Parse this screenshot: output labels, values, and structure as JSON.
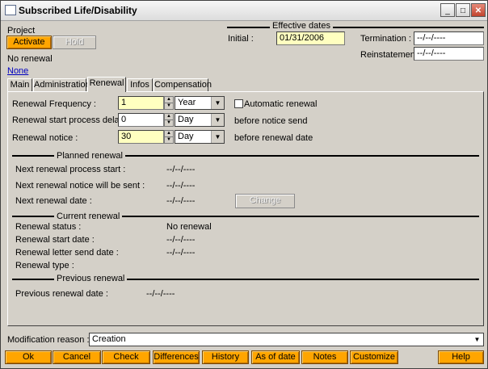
{
  "window": {
    "title": "Subscribed Life/Disability"
  },
  "project": {
    "label": "Project",
    "activate_label": "Activate",
    "hold_label": "Hold",
    "renewal_status": "No renewal",
    "none_link": "None"
  },
  "effective_dates": {
    "title": "Effective dates",
    "initial_label": "Initial :",
    "initial_value": "01/31/2006",
    "termination_label": "Termination :",
    "termination_value": "--/--/----",
    "reinstatement_label": "Reinstatement :",
    "reinstatement_value": "--/--/----"
  },
  "tabs": [
    {
      "label": "Main"
    },
    {
      "label": "Administration"
    },
    {
      "label": "Renewal"
    },
    {
      "label": "Infos"
    },
    {
      "label": "Compensation"
    }
  ],
  "renewal": {
    "frequency_label": "Renewal Frequency :",
    "frequency_value": "1",
    "frequency_unit": "Year",
    "automatic_label": "Automatic renewal",
    "delay_label": "Renewal start process delay :",
    "delay_value": "0",
    "delay_unit": "Day",
    "delay_suffix": "before notice send",
    "notice_label": "Renewal notice :",
    "notice_value": "30",
    "notice_unit": "Day",
    "notice_suffix": "before renewal date"
  },
  "planned": {
    "title": "Planned renewal",
    "next_start_label": "Next renewal process start :",
    "next_start_value": "--/--/----",
    "next_notice_label": "Next renewal notice will be sent :",
    "next_notice_value": "--/--/----",
    "next_date_label": "Next renewal date :",
    "next_date_value": "--/--/----",
    "change_label": "Change"
  },
  "current": {
    "title": "Current renewal",
    "status_label": "Renewal status :",
    "status_value": "No renewal",
    "start_label": "Renewal start date :",
    "start_value": "--/--/----",
    "letter_label": "Renewal letter send date :",
    "letter_value": "--/--/----",
    "type_label": "Renewal type :"
  },
  "previous": {
    "title": "Previous renewal",
    "date_label": "Previous renewal date :",
    "date_value": "--/--/----"
  },
  "modification": {
    "label": "Modification reason :",
    "value": "Creation"
  },
  "buttons": {
    "ok": "Ok",
    "cancel": "Cancel",
    "check": "Check",
    "differences": "Differences",
    "history": "History",
    "as_of_date": "As of date",
    "notes": "Notes",
    "customize": "Customize",
    "help": "Help"
  },
  "colors": {
    "accent": "#ffa500",
    "highlight_field": "#ffffc0",
    "window_bg": "#d4d0c8"
  }
}
